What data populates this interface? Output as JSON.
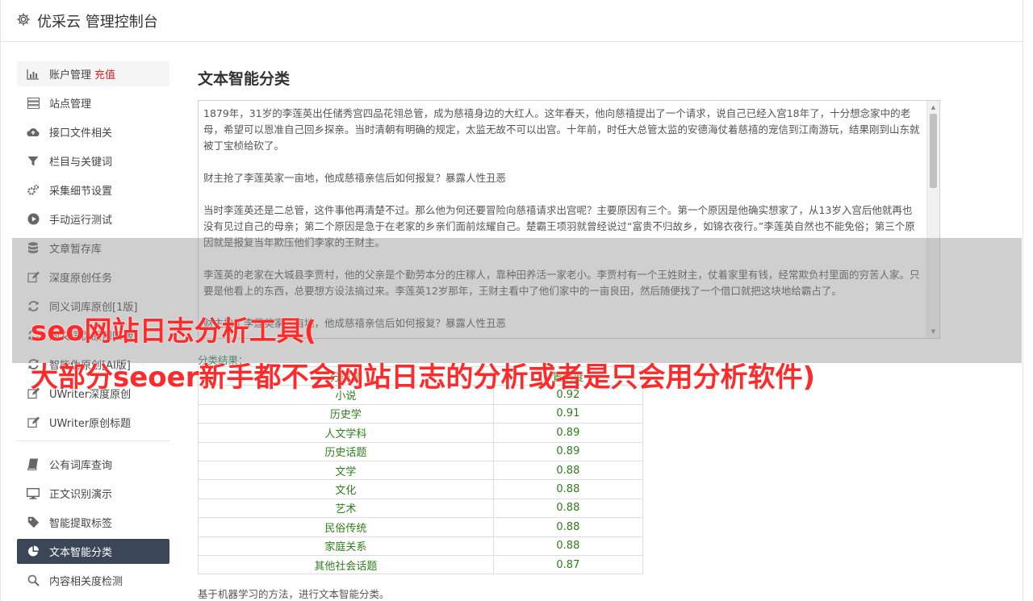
{
  "header": {
    "title": "优采云 管理控制台"
  },
  "sidebar": {
    "group1": [
      {
        "label": "账户管理",
        "badge": "充值",
        "icon": "bar-chart-icon"
      },
      {
        "label": "站点管理",
        "icon": "server-icon"
      },
      {
        "label": "接口文件相关",
        "icon": "cloud-upload-icon"
      },
      {
        "label": "栏目与关键词",
        "icon": "filter-icon"
      },
      {
        "label": "采集细节设置",
        "icon": "gears-icon"
      },
      {
        "label": "手动运行测试",
        "icon": "play-icon"
      },
      {
        "label": "文章暂存库",
        "icon": "database-icon"
      },
      {
        "label": "深度原创任务",
        "icon": "edit-icon"
      },
      {
        "label": "同义词库原创[1版]",
        "icon": "refresh-icon"
      },
      {
        "label": "同义词伪原创[2版]",
        "icon": "refresh-icon"
      },
      {
        "label": "智能伪原创[AI版]",
        "icon": "refresh-icon"
      },
      {
        "label": "UWriter深度原创",
        "icon": "edit-icon"
      },
      {
        "label": "UWriter原创标题",
        "icon": "edit-icon"
      }
    ],
    "group2": [
      {
        "label": "公有词库查询",
        "icon": "book-icon"
      },
      {
        "label": "正文识别演示",
        "icon": "monitor-icon"
      },
      {
        "label": "智能提取标签",
        "icon": "tag-icon"
      },
      {
        "label": "文本智能分类",
        "icon": "pie-chart-icon"
      },
      {
        "label": "内容相关度检测",
        "icon": "search-icon"
      }
    ]
  },
  "main": {
    "title": "文本智能分类",
    "text_paragraphs": [
      "1879年，31岁的李莲英出任储秀宫四品花翎总管，成为慈禧身边的大红人。这年春天，他向慈禧提出了一个请求，说自己已经入宫18年了，十分想念家中的老母，希望可以恩准自己回乡探亲。当时清朝有明确的规定，太监无故不可以出宫。十年前，时任大总管太监的安德海仗着慈禧的宠信到江南游玩，结果刚到山东就被丁宝桢给砍了。",
      "财主抢了李莲英家一亩地，他成慈禧亲信后如何报复？暴露人性丑恶",
      "当时李莲英还是二总管，这件事他再清楚不过。那么他为何还要冒险向慈禧请求出宫呢？主要原因有三个。第一个原因是他确实想家了，从13岁入宫后他就再也没有见过自己的母亲；第二个原因是急于在老家的乡亲们面前炫耀自己。楚霸王项羽就曾经说过“富贵不归故乡，如锦衣夜行。”李莲英自然也不能免俗；第三个原因就是报复当年欺压他们李家的王财主。",
      "李莲英的老家在大城县李贾村，他的父亲是个勤劳本分的庄稼人，靠种田养活一家老小。李贾村有一个王姓财主，仗着家里有钱，经常欺负村里面的穷苦人家。只要是他看上的东西，总要想方设法搞过来。李莲英12岁那年，王财主看中了他们家中的一亩良田，然后随便找了一个借口就把这块地给霸占了。",
      "财主抢了李莲英家一亩地，他成慈禧亲信后如何报复？暴露人性丑恶"
    ],
    "result_label": "分类结果：",
    "table": {
      "headers": [
        "分类名",
        "置信度"
      ],
      "rows": [
        [
          "小说",
          "0.92"
        ],
        [
          "历史学",
          "0.91"
        ],
        [
          "人文学科",
          "0.89"
        ],
        [
          "历史话题",
          "0.89"
        ],
        [
          "文学",
          "0.88"
        ],
        [
          "文化",
          "0.88"
        ],
        [
          "艺术",
          "0.88"
        ],
        [
          "民俗传统",
          "0.88"
        ],
        [
          "家庭关系",
          "0.88"
        ],
        [
          "其他社会话题",
          "0.87"
        ]
      ]
    },
    "description": "基于机器学习的方法，进行文本智能分类。"
  },
  "watermark": {
    "line1": "seo网站日志分析工具(",
    "line2": "大部分seoer新手都不会网站日志的分析或者是只会用分析软件)"
  },
  "colors": {
    "active_nav": "#3b4758",
    "badge": "#e02020",
    "result_text": "#2e7d1a",
    "watermark": "#ff2a2a"
  }
}
